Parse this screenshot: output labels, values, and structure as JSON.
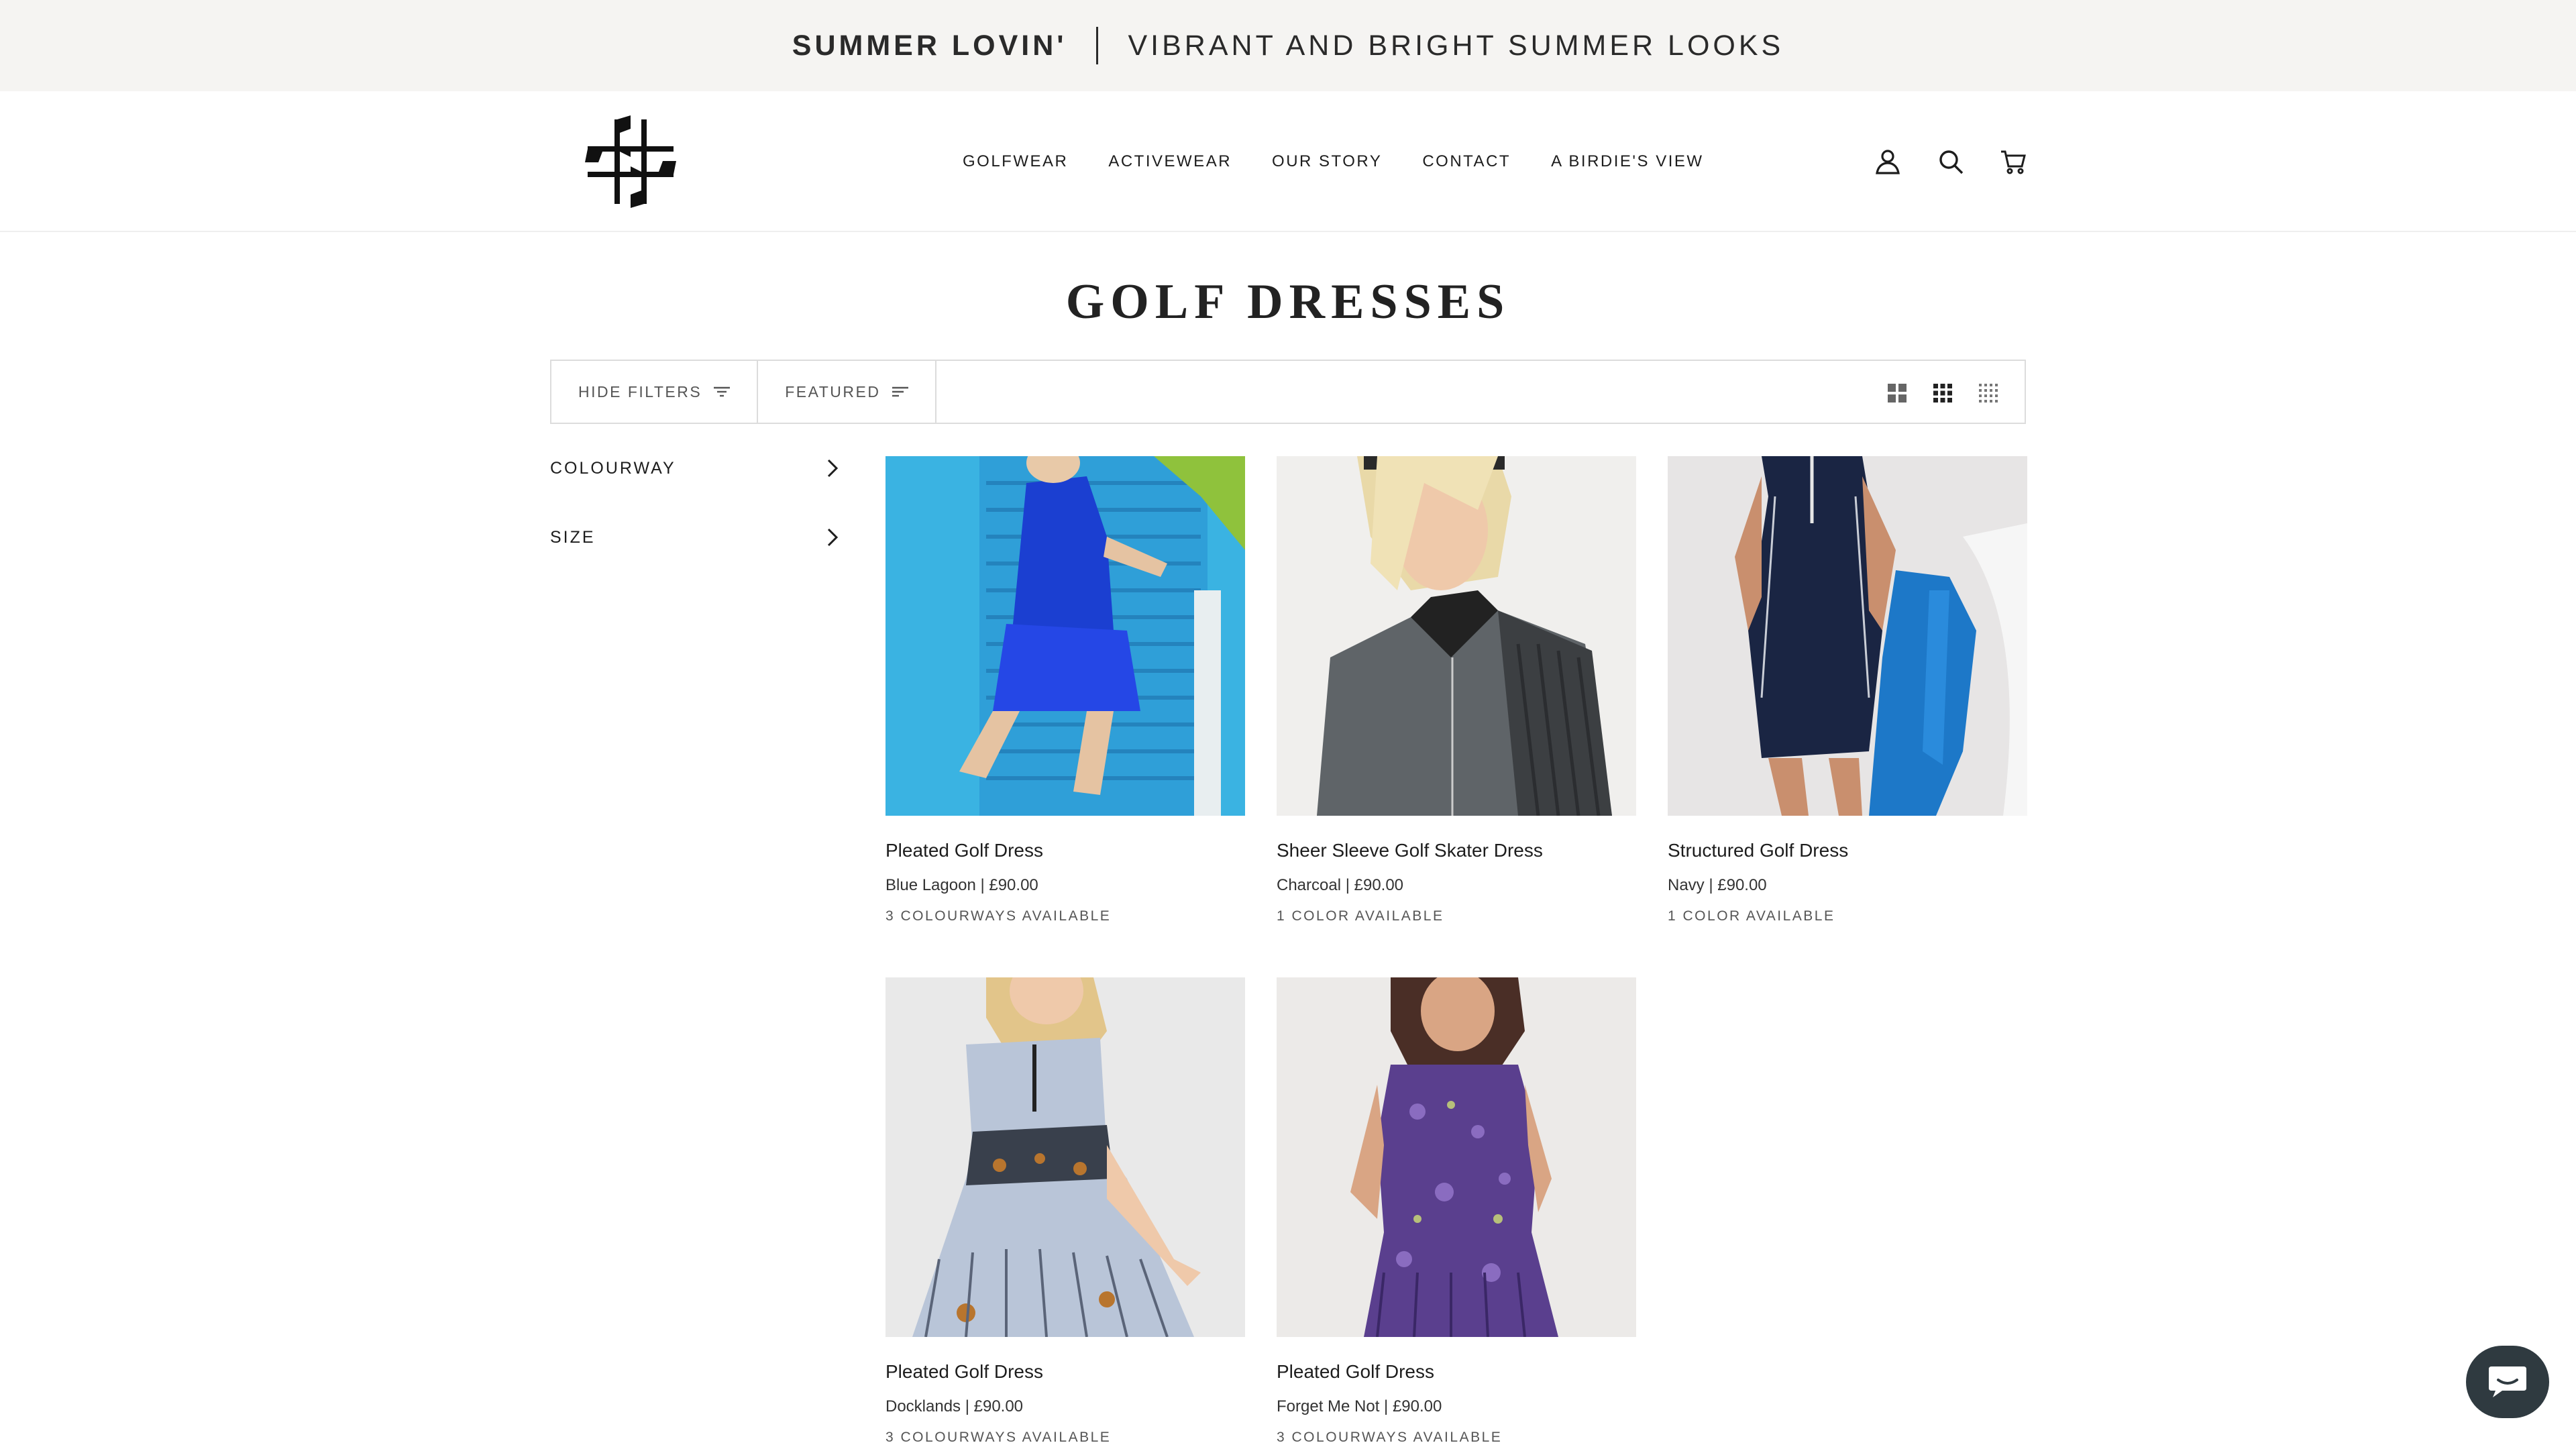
{
  "announcement": {
    "primary": "SUMMER LOVIN'",
    "secondary": "VIBRANT AND BRIGHT SUMMER LOOKS"
  },
  "nav": {
    "items": [
      "GOLFWEAR",
      "ACTIVEWEAR",
      "OUR STORY",
      "CONTACT",
      "A BIRDIE'S VIEW"
    ]
  },
  "header_icons": [
    "account-icon",
    "search-icon",
    "cart-icon"
  ],
  "page": {
    "title": "GOLF DRESSES"
  },
  "toolbar": {
    "filter_label": "HIDE FILTERS",
    "sort_label": "FEATURED"
  },
  "filters": [
    {
      "label": "COLOURWAY"
    },
    {
      "label": "SIZE"
    }
  ],
  "products": [
    {
      "name": "Pleated Golf Dress",
      "variant": "Blue Lagoon | £90.00",
      "availability": "3 COLOURWAYS AVAILABLE"
    },
    {
      "name": "Sheer Sleeve Golf Skater Dress",
      "variant": "Charcoal | £90.00",
      "availability": "1 COLOR AVAILABLE"
    },
    {
      "name": "Structured Golf Dress",
      "variant": "Navy | £90.00",
      "availability": "1 COLOR AVAILABLE"
    },
    {
      "name": "Pleated Golf Dress",
      "variant": "Docklands | £90.00",
      "availability": "3 COLOURWAYS AVAILABLE"
    },
    {
      "name": "Pleated Golf Dress",
      "variant": "Forget Me Not | £90.00",
      "availability": "3 COLOURWAYS AVAILABLE"
    }
  ],
  "colors": {
    "announcement_bg": "#f5f4f2",
    "text": "#1d1d1d",
    "border": "#dcdcdc",
    "chat_bg": "#2f3a40"
  }
}
